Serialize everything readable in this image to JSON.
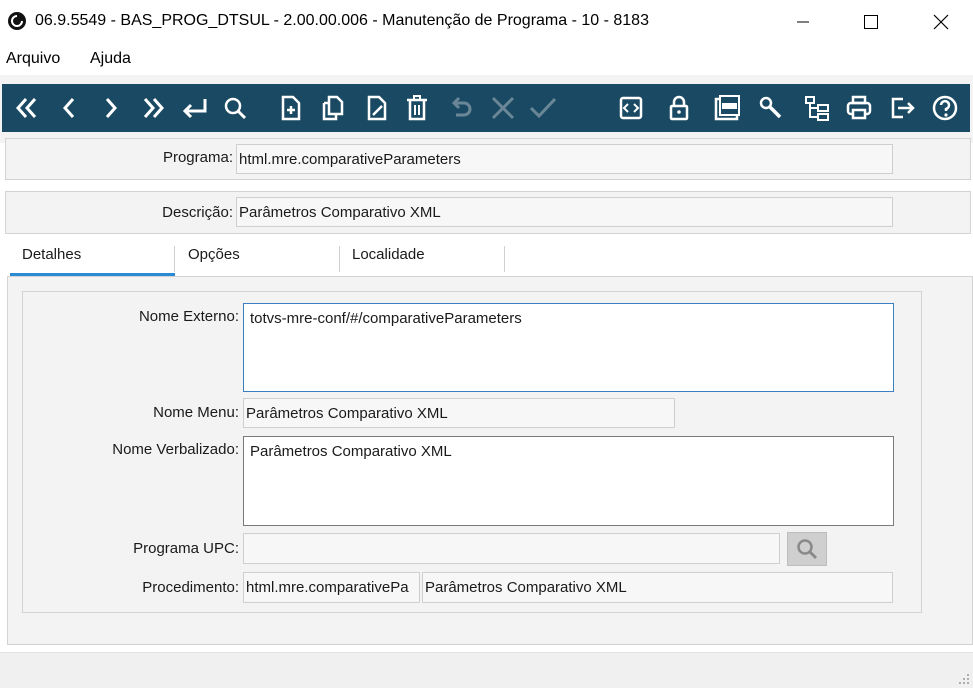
{
  "window": {
    "title": "06.9.5549 - BAS_PROG_DTSUL - 2.00.00.006 - Manutenção de Programa - 10 - 8183"
  },
  "menu": {
    "items": [
      "Arquivo",
      "Ajuda"
    ]
  },
  "toolbar": {
    "icons": [
      "first-icon",
      "prev-icon",
      "next-icon",
      "last-icon",
      "goto-icon",
      "search-icon",
      "new-icon",
      "copy-icon",
      "edit-icon",
      "delete-icon",
      "undo-icon",
      "cancel-icon",
      "save-icon",
      "code-icon",
      "lock-icon",
      "pdf-icon",
      "tools-icon",
      "tree-icon",
      "print-icon",
      "exit-icon",
      "help-icon"
    ],
    "bar_color": "#1a4a63"
  },
  "form": {
    "programa_label": "Programa:",
    "programa_value": "html.mre.comparativeParameters",
    "descricao_label": "Descrição:",
    "descricao_value": "Parâmetros Comparativo XML"
  },
  "tabs": {
    "items": [
      "Detalhes",
      "Opções",
      "Localidade"
    ],
    "active": "Detalhes",
    "accent": "#2a8ad4"
  },
  "detalhes": {
    "nome_externo_label": "Nome Externo:",
    "nome_externo_value": "totvs-mre-conf/#/comparativeParameters",
    "nome_menu_label": "Nome Menu:",
    "nome_menu_value": "Parâmetros Comparativo XML",
    "nome_verbalizado_label": "Nome Verbalizado:",
    "nome_verbalizado_value": "Parâmetros Comparativo XML",
    "programa_upc_label": "Programa UPC:",
    "programa_upc_value": "",
    "procedimento_label": "Procedimento:",
    "procedimento_code": "html.mre.comparativePa",
    "procedimento_desc": "Parâmetros Comparativo XML"
  }
}
